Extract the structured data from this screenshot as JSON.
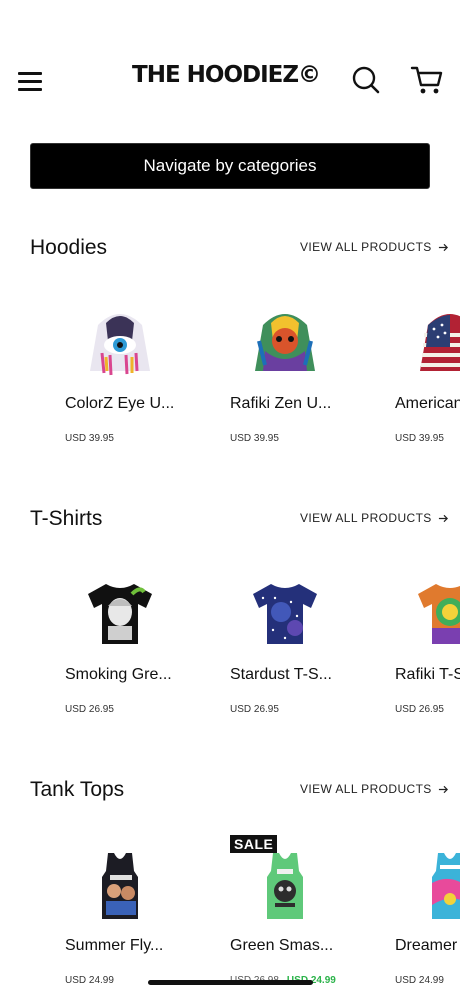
{
  "header": {
    "logo": "THE HOODIEZ©",
    "menu_icon": "hamburger-menu-icon",
    "search_icon": "search-icon",
    "cart_icon": "shopping-cart-icon"
  },
  "categories_button": "Navigate by categories",
  "sections": [
    {
      "title": "Hoodies",
      "view_all": "VIEW ALL PRODUCTS",
      "products": [
        {
          "name": "ColorZ Eye U...",
          "price": "USD 39.95"
        },
        {
          "name": "Rafiki Zen U...",
          "price": "USD 39.95"
        },
        {
          "name": "American",
          "price": "USD 39.95"
        }
      ]
    },
    {
      "title": "T-Shirts",
      "view_all": "VIEW ALL PRODUCTS",
      "products": [
        {
          "name": "Smoking Gre...",
          "price": "USD 26.95"
        },
        {
          "name": "Stardust T-S...",
          "price": "USD 26.95"
        },
        {
          "name": "Rafiki T-S",
          "price": "USD 26.95"
        }
      ]
    },
    {
      "title": "Tank Tops",
      "view_all": "VIEW ALL PRODUCTS",
      "products": [
        {
          "name": "Summer Fly...",
          "price": "USD 24.99"
        },
        {
          "name": "Green Smas...",
          "old_price": "USD 26.98",
          "sale_price": "USD 24.99",
          "badge": "SALE"
        },
        {
          "name": "Dreamer",
          "price": "USD 24.99"
        }
      ]
    }
  ],
  "colors": {
    "accent": "#000000",
    "sale_price": "#2bb34a"
  }
}
